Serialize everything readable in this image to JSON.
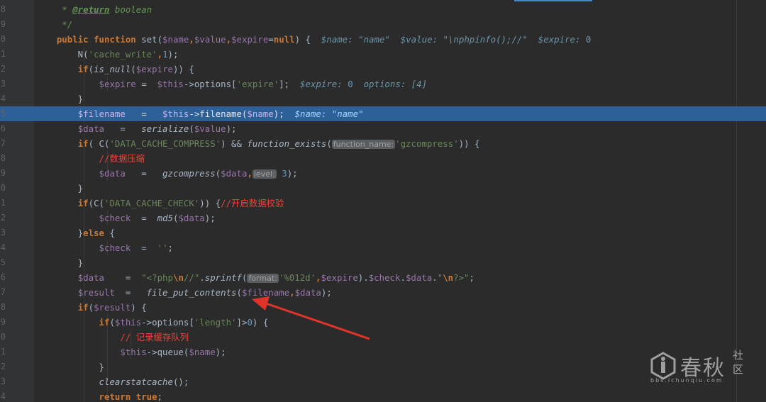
{
  "line_numbers": [
    "8",
    "9",
    "0",
    "1",
    "2",
    "3",
    "4",
    "5",
    "6",
    "7",
    "8",
    "9",
    "0",
    "1",
    "2",
    "3",
    "4",
    "5",
    "6",
    "7",
    "8",
    "9",
    "0",
    "1",
    "2",
    "3",
    "4"
  ],
  "highlighted_line_index": 7,
  "lines": [
    [
      {
        "t": "     * ",
        "c": "doc"
      },
      {
        "t": "@return",
        "c": "doctag"
      },
      {
        "t": " boolean",
        "c": "doc"
      }
    ],
    [
      {
        "t": "     */",
        "c": "doc"
      }
    ],
    [
      {
        "t": "    ",
        "c": ""
      },
      {
        "t": "public function ",
        "c": "kw"
      },
      {
        "t": "set(",
        "c": ""
      },
      {
        "t": "$name",
        "c": "var"
      },
      {
        "t": ",",
        "c": "kw"
      },
      {
        "t": "$value",
        "c": "var"
      },
      {
        "t": ",",
        "c": "kw"
      },
      {
        "t": "$expire",
        "c": "var"
      },
      {
        "t": "=",
        "c": ""
      },
      {
        "t": "null",
        "c": "kw"
      },
      {
        "t": ") {  ",
        "c": ""
      },
      {
        "t": "$name: ",
        "c": "hint"
      },
      {
        "t": "\"name\"",
        "c": "hint"
      },
      {
        "t": "  $value: ",
        "c": "hint"
      },
      {
        "t": "\"\\nphpinfo();//\"",
        "c": "hint"
      },
      {
        "t": "  $expire: ",
        "c": "hint"
      },
      {
        "t": "0",
        "c": "num"
      }
    ],
    [
      {
        "t": "        N(",
        "c": ""
      },
      {
        "t": "'cache_write'",
        "c": "str"
      },
      {
        "t": ",",
        "c": "kw"
      },
      {
        "t": "1",
        "c": "num"
      },
      {
        "t": ");",
        "c": ""
      }
    ],
    [
      {
        "t": "        ",
        "c": ""
      },
      {
        "t": "if",
        "c": "kw"
      },
      {
        "t": "(",
        "c": ""
      },
      {
        "t": "is_null",
        "c": "it"
      },
      {
        "t": "(",
        "c": ""
      },
      {
        "t": "$expire",
        "c": "var"
      },
      {
        "t": ")) {",
        "c": ""
      }
    ],
    [
      {
        "t": "            ",
        "c": ""
      },
      {
        "t": "$expire",
        "c": "var"
      },
      {
        "t": " =  ",
        "c": ""
      },
      {
        "t": "$this",
        "c": "var"
      },
      {
        "t": "->options[",
        "c": ""
      },
      {
        "t": "'expire'",
        "c": "str"
      },
      {
        "t": "];  ",
        "c": ""
      },
      {
        "t": "$expire: ",
        "c": "hint"
      },
      {
        "t": "0",
        "c": "num"
      },
      {
        "t": "  options: [4]",
        "c": "hint"
      }
    ],
    [
      {
        "t": "        }",
        "c": ""
      }
    ],
    [
      {
        "t": "        ",
        "c": ""
      },
      {
        "t": "$filename",
        "c": "var"
      },
      {
        "t": "   =   ",
        "c": ""
      },
      {
        "t": "$this",
        "c": "var"
      },
      {
        "t": "->filename(",
        "c": ""
      },
      {
        "t": "$name",
        "c": "var"
      },
      {
        "t": ");  ",
        "c": ""
      },
      {
        "t": "$name: ",
        "c": "hint"
      },
      {
        "t": "\"name\"",
        "c": "hint"
      }
    ],
    [
      {
        "t": "        ",
        "c": ""
      },
      {
        "t": "$data",
        "c": "var"
      },
      {
        "t": "   =   ",
        "c": ""
      },
      {
        "t": "serialize",
        "c": "it"
      },
      {
        "t": "(",
        "c": ""
      },
      {
        "t": "$value",
        "c": "var"
      },
      {
        "t": ");",
        "c": ""
      }
    ],
    [
      {
        "t": "        ",
        "c": ""
      },
      {
        "t": "if",
        "c": "kw"
      },
      {
        "t": "( C(",
        "c": ""
      },
      {
        "t": "'DATA_CACHE_COMPRESS'",
        "c": "str"
      },
      {
        "t": ") && ",
        "c": ""
      },
      {
        "t": "function_exists",
        "c": "it"
      },
      {
        "t": "(",
        "c": ""
      },
      {
        "t": "function_name:",
        "c": "param"
      },
      {
        "t": "'gzcompress'",
        "c": "str"
      },
      {
        "t": ")) {",
        "c": ""
      }
    ],
    [
      {
        "t": "            ",
        "c": ""
      },
      {
        "t": "//数据压缩",
        "c": "cmcn"
      }
    ],
    [
      {
        "t": "            ",
        "c": ""
      },
      {
        "t": "$data",
        "c": "var"
      },
      {
        "t": "   =   ",
        "c": ""
      },
      {
        "t": "gzcompress",
        "c": "it"
      },
      {
        "t": "(",
        "c": ""
      },
      {
        "t": "$data",
        "c": "var"
      },
      {
        "t": ",",
        "c": "kw"
      },
      {
        "t": "level:",
        "c": "param"
      },
      {
        "t": " 3",
        "c": "num"
      },
      {
        "t": ");",
        "c": ""
      }
    ],
    [
      {
        "t": "        }",
        "c": ""
      }
    ],
    [
      {
        "t": "        ",
        "c": ""
      },
      {
        "t": "if",
        "c": "kw"
      },
      {
        "t": "(C(",
        "c": ""
      },
      {
        "t": "'DATA_CACHE_CHECK'",
        "c": "str"
      },
      {
        "t": ")) {",
        "c": ""
      },
      {
        "t": "//开启数据校验",
        "c": "cmcn"
      }
    ],
    [
      {
        "t": "            ",
        "c": ""
      },
      {
        "t": "$check",
        "c": "var"
      },
      {
        "t": "  =  ",
        "c": ""
      },
      {
        "t": "md5",
        "c": "it"
      },
      {
        "t": "(",
        "c": ""
      },
      {
        "t": "$data",
        "c": "var"
      },
      {
        "t": ");",
        "c": ""
      }
    ],
    [
      {
        "t": "        }",
        "c": ""
      },
      {
        "t": "else",
        "c": "kw"
      },
      {
        "t": " {",
        "c": ""
      }
    ],
    [
      {
        "t": "            ",
        "c": ""
      },
      {
        "t": "$check",
        "c": "var"
      },
      {
        "t": "  =  ",
        "c": ""
      },
      {
        "t": "''",
        "c": "str"
      },
      {
        "t": ";",
        "c": ""
      }
    ],
    [
      {
        "t": "        }",
        "c": ""
      }
    ],
    [
      {
        "t": "        ",
        "c": ""
      },
      {
        "t": "$data",
        "c": "var"
      },
      {
        "t": "    =  ",
        "c": ""
      },
      {
        "t": "\"<?php",
        "c": "str"
      },
      {
        "t": "\\n",
        "c": "esc"
      },
      {
        "t": "//\"",
        "c": "str"
      },
      {
        "t": ".",
        "c": ""
      },
      {
        "t": "sprintf",
        "c": "it"
      },
      {
        "t": "(",
        "c": ""
      },
      {
        "t": "format:",
        "c": "param"
      },
      {
        "t": "'%012d'",
        "c": "str"
      },
      {
        "t": ",",
        "c": "kw"
      },
      {
        "t": "$expire",
        "c": "var"
      },
      {
        "t": ").",
        "c": ""
      },
      {
        "t": "$check",
        "c": "var"
      },
      {
        "t": ".",
        "c": ""
      },
      {
        "t": "$data",
        "c": "var"
      },
      {
        "t": ".",
        "c": ""
      },
      {
        "t": "\"",
        "c": "str"
      },
      {
        "t": "\\n",
        "c": "esc"
      },
      {
        "t": "?>\"",
        "c": "str"
      },
      {
        "t": ";",
        "c": ""
      }
    ],
    [
      {
        "t": "        ",
        "c": ""
      },
      {
        "t": "$result",
        "c": "var"
      },
      {
        "t": "  =   ",
        "c": ""
      },
      {
        "t": "file_put_contents",
        "c": "it"
      },
      {
        "t": "(",
        "c": ""
      },
      {
        "t": "$filename",
        "c": "var"
      },
      {
        "t": ",",
        "c": "kw"
      },
      {
        "t": "$data",
        "c": "var"
      },
      {
        "t": ");",
        "c": ""
      }
    ],
    [
      {
        "t": "        ",
        "c": ""
      },
      {
        "t": "if",
        "c": "kw"
      },
      {
        "t": "(",
        "c": ""
      },
      {
        "t": "$result",
        "c": "var"
      },
      {
        "t": ") {",
        "c": ""
      }
    ],
    [
      {
        "t": "            ",
        "c": ""
      },
      {
        "t": "if",
        "c": "kw"
      },
      {
        "t": "(",
        "c": ""
      },
      {
        "t": "$this",
        "c": "var"
      },
      {
        "t": "->options[",
        "c": ""
      },
      {
        "t": "'length'",
        "c": "str"
      },
      {
        "t": "]>",
        "c": ""
      },
      {
        "t": "0",
        "c": "num"
      },
      {
        "t": ") {",
        "c": ""
      }
    ],
    [
      {
        "t": "                ",
        "c": ""
      },
      {
        "t": "// 记录缓存队列",
        "c": "cmcn"
      }
    ],
    [
      {
        "t": "                ",
        "c": ""
      },
      {
        "t": "$this",
        "c": "var"
      },
      {
        "t": "->queue(",
        "c": ""
      },
      {
        "t": "$name",
        "c": "var"
      },
      {
        "t": ");",
        "c": ""
      }
    ],
    [
      {
        "t": "            }",
        "c": ""
      }
    ],
    [
      {
        "t": "            ",
        "c": ""
      },
      {
        "t": "clearstatcache",
        "c": "it"
      },
      {
        "t": "();",
        "c": ""
      }
    ],
    [
      {
        "t": "            ",
        "c": ""
      },
      {
        "t": "return true",
        "c": "kw"
      },
      {
        "t": ";",
        "c": ""
      }
    ]
  ],
  "watermark": {
    "brand": "春秋",
    "suffix_top": "社",
    "suffix_bottom": "区",
    "url": "bbs.ichunqiu.com"
  },
  "colors": {
    "background": "#2b2b2b",
    "highlight": "#2d6099",
    "arrow": "#e0342a"
  }
}
